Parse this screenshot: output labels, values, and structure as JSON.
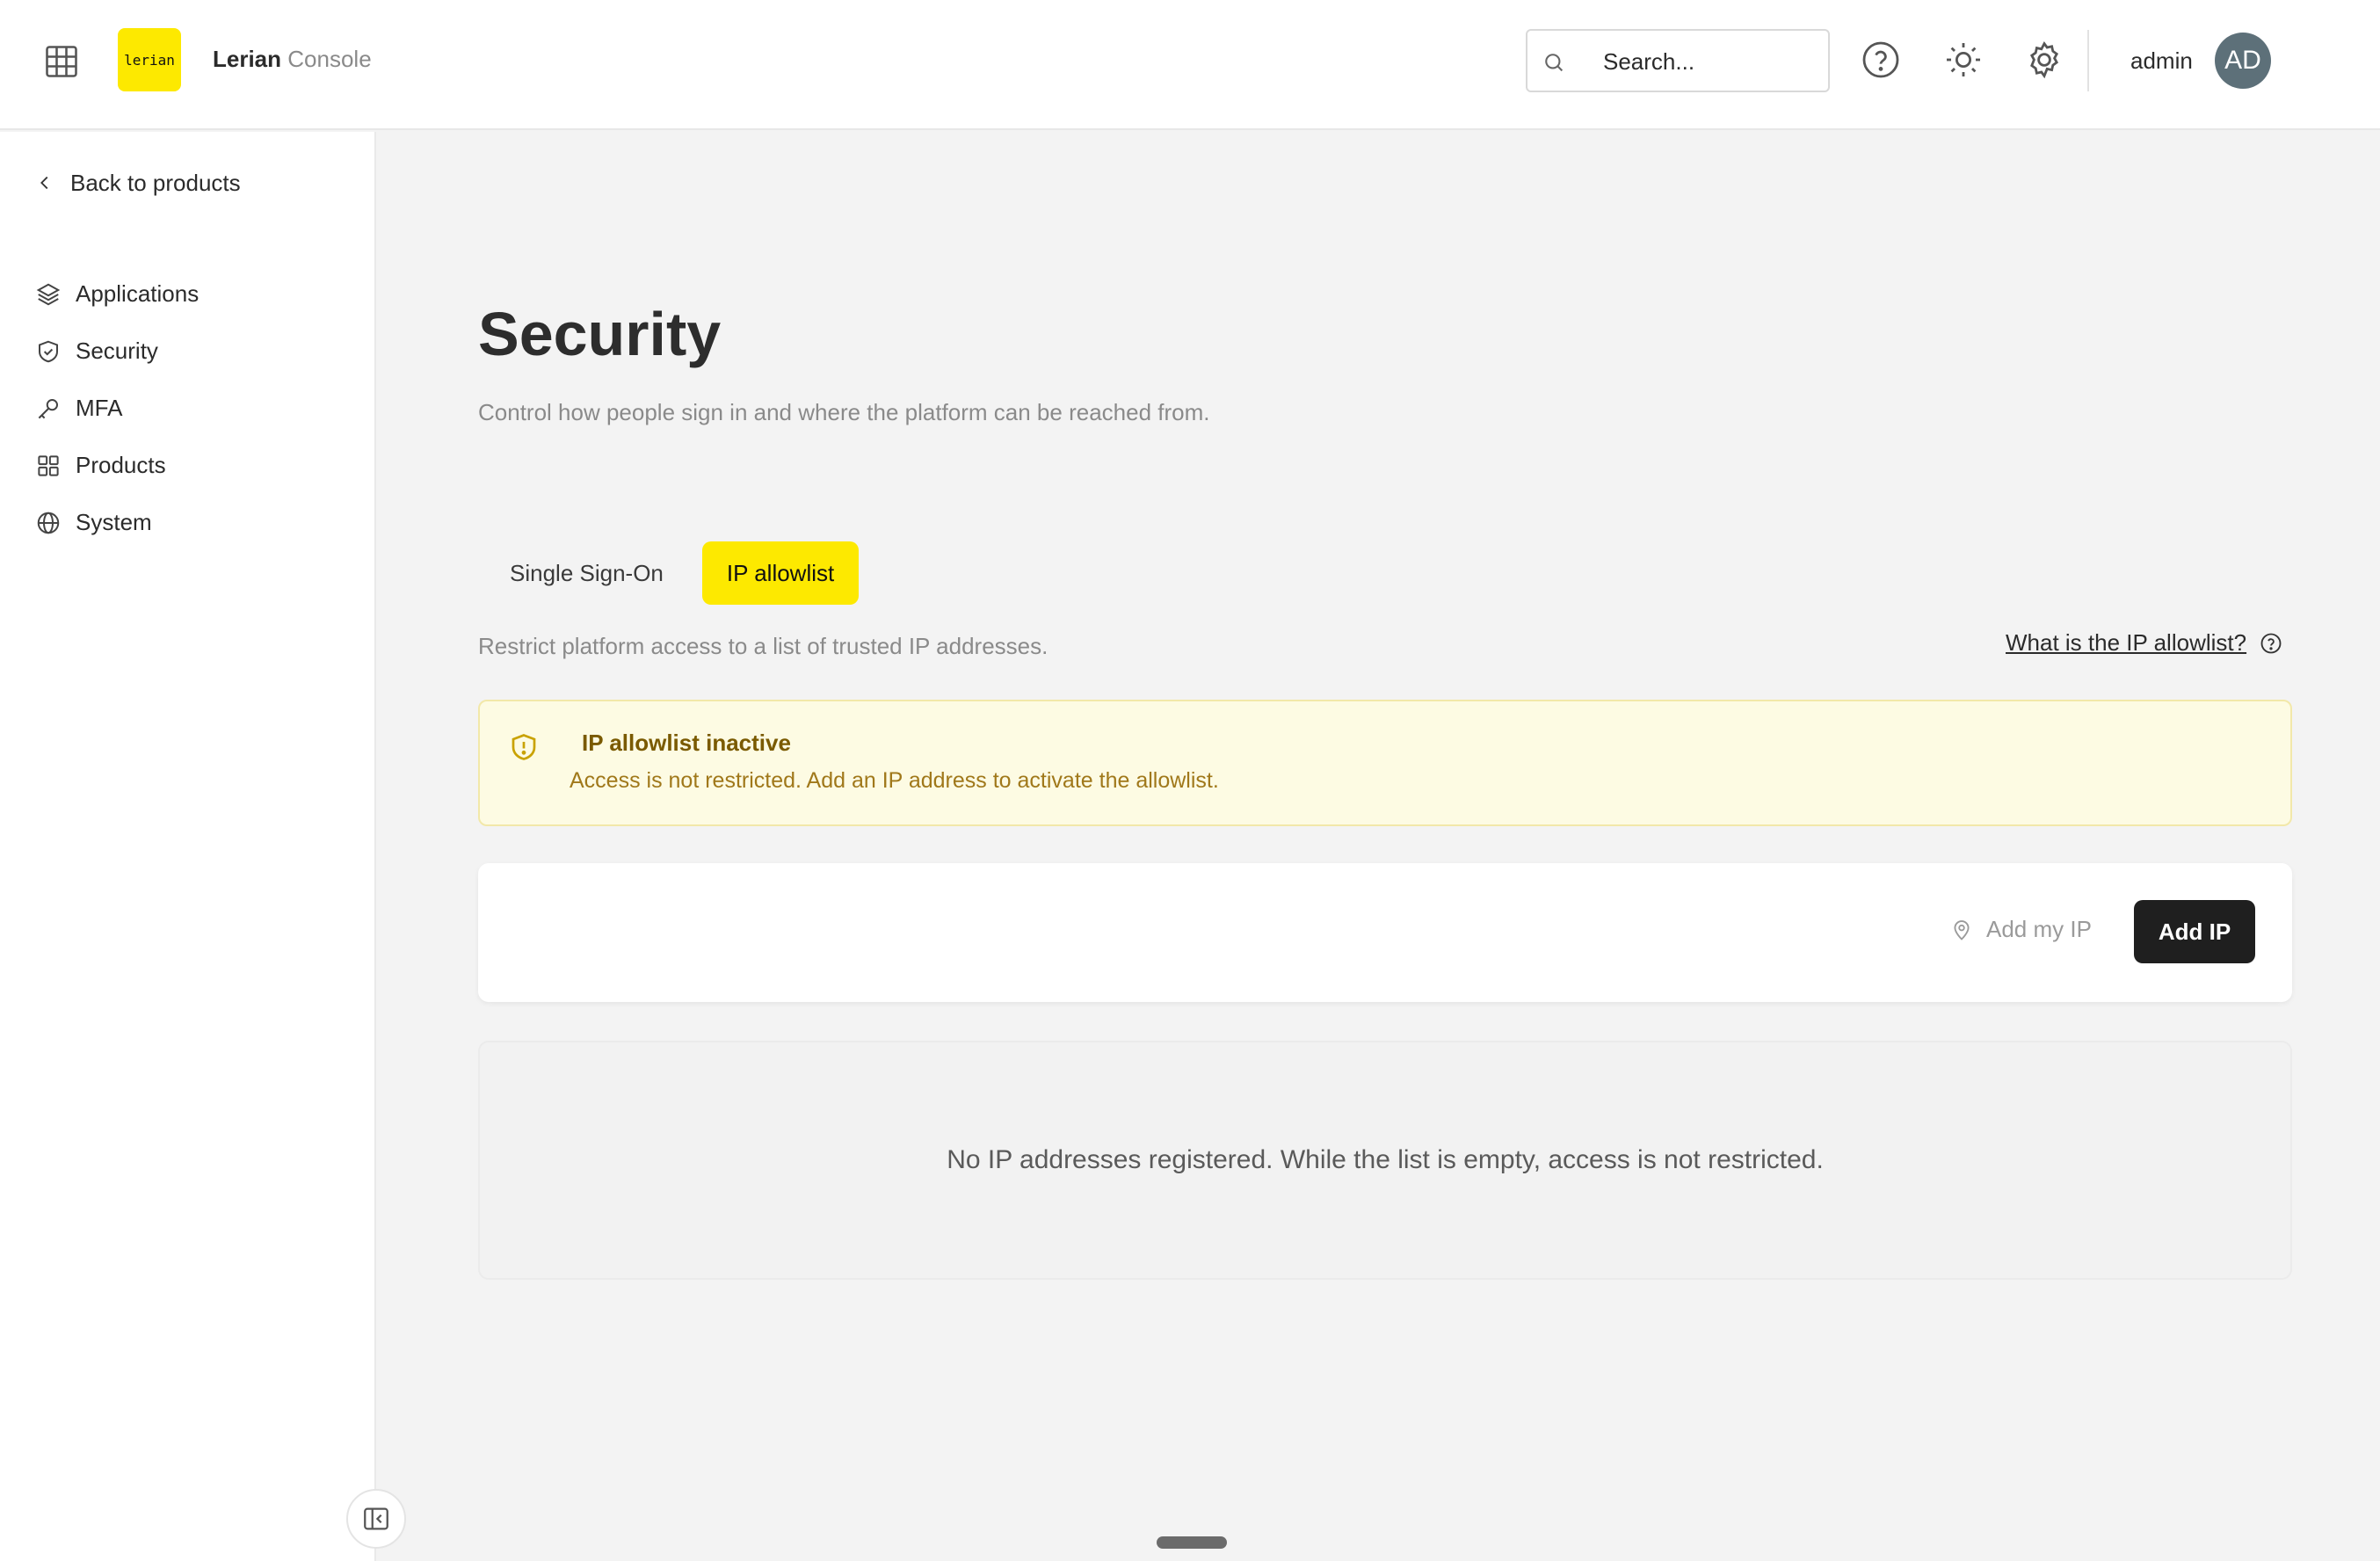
{
  "header": {
    "logo_text": "lerian",
    "brand_name": "Lerian",
    "brand_suffix": "Console",
    "search_placeholder": "Search...",
    "username": "admin",
    "avatar_initials": "AD"
  },
  "sidebar": {
    "back_label": "Back to products",
    "items": [
      {
        "label": "Applications",
        "icon": "layers-icon"
      },
      {
        "label": "Security",
        "icon": "shield-icon"
      },
      {
        "label": "MFA",
        "icon": "key-icon"
      },
      {
        "label": "Products",
        "icon": "grid-icon"
      },
      {
        "label": "System",
        "icon": "globe-icon"
      }
    ]
  },
  "main": {
    "title": "Security",
    "subtitle": "Control how people sign in and where the platform can be reached from.",
    "tabs": [
      {
        "label": "Single Sign-On",
        "active": false
      },
      {
        "label": "IP allowlist",
        "active": true
      }
    ],
    "tab_description": "Restrict platform access to a list of trusted IP addresses.",
    "help_link": "What is the IP allowlist?",
    "alert": {
      "title": "IP allowlist inactive",
      "body": "Access is not restricted. Add an IP address to activate the allowlist."
    },
    "actions": {
      "add_my_ip": "Add my IP",
      "add_ip": "Add IP"
    },
    "empty_message": "No IP addresses registered. While the list is empty, access is not restricted."
  },
  "colors": {
    "accent_yellow": "#fde900",
    "primary_button": "#1f1f1f",
    "alert_background": "#fdfbe3",
    "avatar_background": "#5d7079"
  }
}
